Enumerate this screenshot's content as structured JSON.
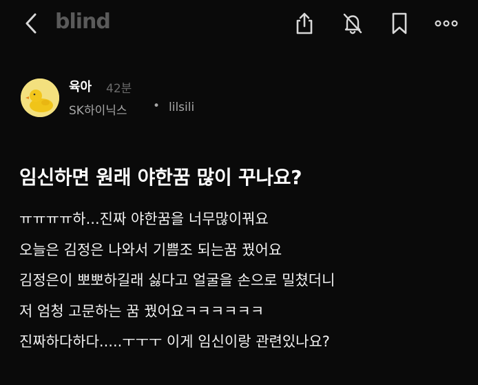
{
  "header": {
    "logo": "blind",
    "icons": [
      "back-icon",
      "share-icon",
      "bell-off-icon",
      "bookmark-icon",
      "more-icon"
    ]
  },
  "author": {
    "name": "육아",
    "time": "42분",
    "company": "SK하이닉스",
    "separator": "•",
    "handle": "lilsili"
  },
  "post": {
    "title": "임신하면 원래 야한꿈 많이 꾸나요?",
    "lines": [
      "ㅠㅠㅠㅠ하...진짜 야한꿈을 너무많이꿔요",
      "오늘은 김정은 나와서 기쁨조 되는꿈 꿨어요",
      "김정은이 뽀뽀하길래 싫다고 얼굴을 손으로 밀쳤더니",
      "저 엄청 고문하는 꿈 꿨어요ㅋㅋㅋㅋㅋㅋ",
      "진짜하다하다.....ㅜㅜㅜ 이게 임신이랑 관련있나요?"
    ]
  }
}
